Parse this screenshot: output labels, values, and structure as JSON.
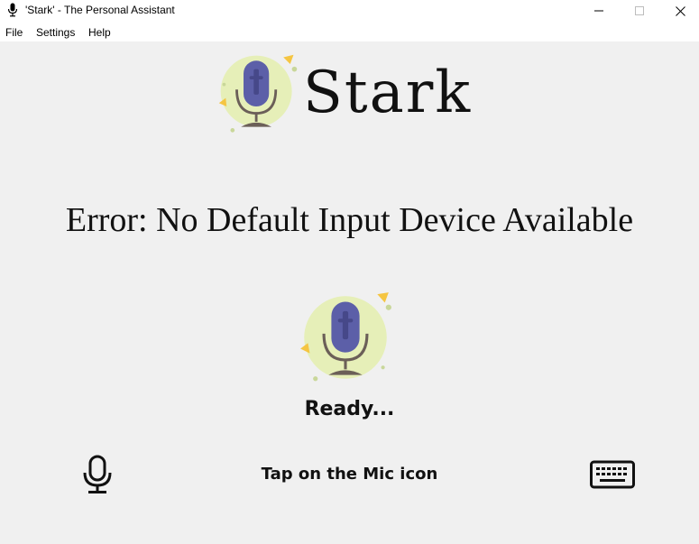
{
  "window": {
    "title": "'Stark' - The Personal Assistant",
    "controls": {
      "minimize": "—",
      "maximize": "☐",
      "close": "✕"
    }
  },
  "menu": [
    {
      "label": "File"
    },
    {
      "label": "Settings"
    },
    {
      "label": "Help"
    }
  ],
  "brand": {
    "name": "Stark"
  },
  "error_message": "Error: No Default Input Device Available",
  "status": "Ready...",
  "prompt": "Tap on the Mic icon",
  "icons": {
    "title_icon": "microphone-icon",
    "logo": "microphone-logo",
    "speak": "microphone-icon",
    "keyboard": "keyboard-icon"
  },
  "colors": {
    "background": "#f0f0f0",
    "logo_circle": "#e6efb8",
    "mic_body": "#5c5fa8",
    "accent_yellow": "#f5c542",
    "stand": "#6b5f58"
  }
}
